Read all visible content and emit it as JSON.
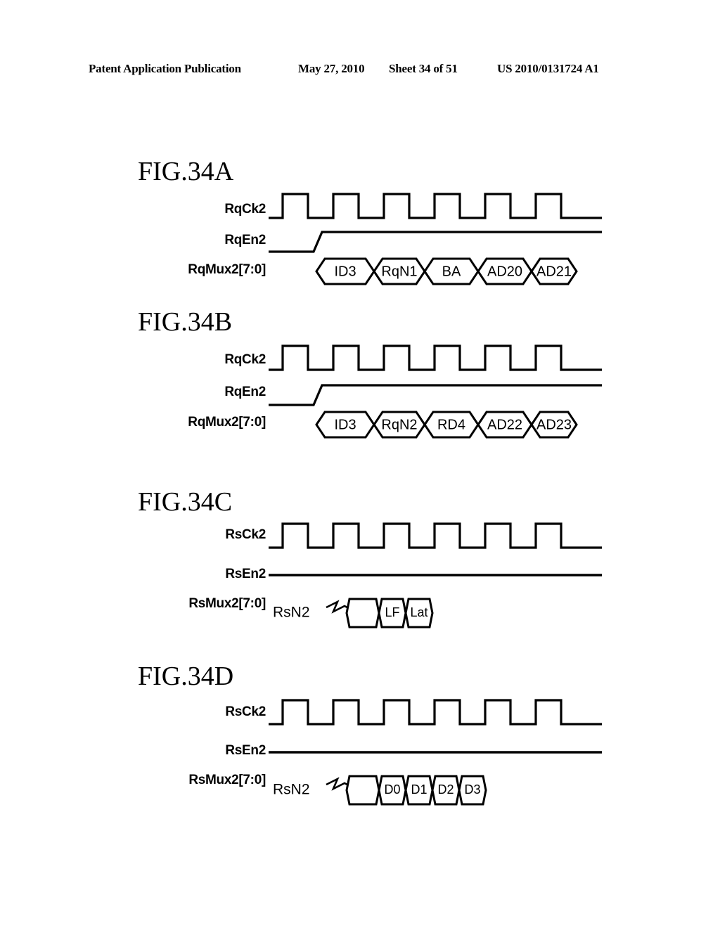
{
  "header": {
    "publication": "Patent Application Publication",
    "date": "May 27, 2010",
    "sheet": "Sheet 34 of 51",
    "patent_number": "US 2010/0131724 A1"
  },
  "figures": [
    {
      "title": "FIG.34A",
      "rows": [
        {
          "label": "RqCk2",
          "type": "clock"
        },
        {
          "label": "RqEn2",
          "type": "enable-rising"
        },
        {
          "label": "RqMux2[7:0]",
          "type": "bus"
        }
      ],
      "bus_cells": [
        "ID3",
        "RqN1",
        "BA",
        "AD20",
        "AD21"
      ]
    },
    {
      "title": "FIG.34B",
      "rows": [
        {
          "label": "RqCk2",
          "type": "clock"
        },
        {
          "label": "RqEn2",
          "type": "enable-rising"
        },
        {
          "label": "RqMux2[7:0]",
          "type": "bus"
        }
      ],
      "bus_cells": [
        "ID3",
        "RqN2",
        "RD4",
        "AD22",
        "AD23"
      ]
    },
    {
      "title": "FIG.34C",
      "rows": [
        {
          "label": "RsCk2",
          "type": "clock"
        },
        {
          "label": "RsEn2",
          "type": "flat"
        },
        {
          "label": "RsMux2[7:0]",
          "type": "bus-annotated"
        }
      ],
      "annotation": "RsN2",
      "bus_cells": [
        "",
        "LF",
        "Lat"
      ]
    },
    {
      "title": "FIG.34D",
      "rows": [
        {
          "label": "RsCk2",
          "type": "clock"
        },
        {
          "label": "RsEn2",
          "type": "flat"
        },
        {
          "label": "RsMux2[7:0]",
          "type": "bus-annotated"
        }
      ],
      "annotation": "RsN2",
      "bus_cells": [
        "",
        "D0",
        "D1",
        "D2",
        "D3"
      ]
    }
  ],
  "waveform": {
    "clock_pulses": 6,
    "clock_color": "#000000",
    "background_color": "#ffffff"
  }
}
